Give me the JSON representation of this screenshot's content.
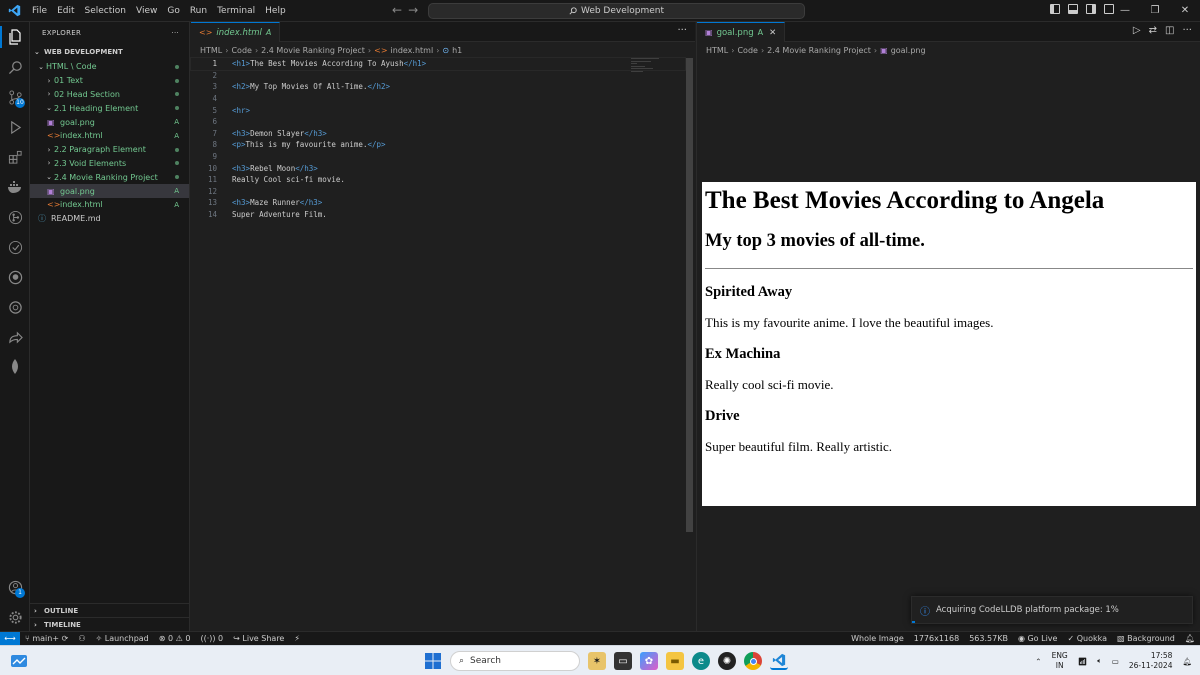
{
  "menu": [
    "File",
    "Edit",
    "Selection",
    "View",
    "Go",
    "Run",
    "Terminal",
    "Help"
  ],
  "command_center": "Web Development",
  "activity_badges": {
    "source_control": "10",
    "accounts": "1"
  },
  "explorer": {
    "title": "EXPLORER",
    "workspace": "WEB DEVELOPMENT",
    "items": [
      {
        "label": "HTML \\ Code",
        "status": "dot"
      },
      {
        "label": "01 Text",
        "status": "dot"
      },
      {
        "label": "02 Head Section",
        "status": "dot"
      },
      {
        "label": "2.1 Heading Element",
        "status": "dot"
      },
      {
        "label": "goal.png",
        "status": "A"
      },
      {
        "label": "index.html",
        "status": "A"
      },
      {
        "label": "2.2 Paragraph Element",
        "status": "dot"
      },
      {
        "label": "2.3 Void Elements",
        "status": "dot"
      },
      {
        "label": "2.4 Movie Ranking Project",
        "status": "dot"
      },
      {
        "label": "goal.png",
        "status": "A"
      },
      {
        "label": "index.html",
        "status": "A"
      },
      {
        "label": "README.md",
        "status": ""
      }
    ],
    "outline": "OUTLINE",
    "timeline": "TIMELINE"
  },
  "left_editor": {
    "tab_label": "index.html",
    "tab_status": "A",
    "breadcrumb": [
      "HTML",
      "Code",
      "2.4 Movie Ranking Project",
      "index.html",
      "h1"
    ],
    "lines": [
      {
        "n": "1",
        "pre": "",
        "open": "<h1>",
        "text": "The Best Movies According To Ayush",
        "close": "</h1>"
      },
      {
        "n": "2",
        "pre": "",
        "open": "",
        "text": "",
        "close": ""
      },
      {
        "n": "3",
        "pre": "",
        "open": "<h2>",
        "text": "My Top Movies Of All-Time.",
        "close": "</h2>"
      },
      {
        "n": "4",
        "pre": "",
        "open": "",
        "text": "",
        "close": ""
      },
      {
        "n": "5",
        "pre": "",
        "open": "<hr>",
        "text": "",
        "close": ""
      },
      {
        "n": "6",
        "pre": "",
        "open": "",
        "text": "",
        "close": ""
      },
      {
        "n": "7",
        "pre": "",
        "open": "<h3>",
        "text": "Demon Slayer",
        "close": "</h3>"
      },
      {
        "n": "8",
        "pre": "",
        "open": "<p>",
        "text": "This is my favourite anime.",
        "close": "</p>"
      },
      {
        "n": "9",
        "pre": "",
        "open": "",
        "text": "",
        "close": ""
      },
      {
        "n": "10",
        "pre": "",
        "open": "<h3>",
        "text": "Rebel Moon",
        "close": "</h3>"
      },
      {
        "n": "11",
        "pre": "",
        "open": "",
        "text": "Really Cool sci-fi movie.",
        "close": ""
      },
      {
        "n": "12",
        "pre": "",
        "open": "",
        "text": "",
        "close": ""
      },
      {
        "n": "13",
        "pre": "",
        "open": "<h3>",
        "text": "Maze Runner",
        "close": "</h3>"
      },
      {
        "n": "14",
        "pre": "",
        "open": "",
        "text": "Super Adventure Film.",
        "close": ""
      }
    ]
  },
  "right_editor": {
    "tab_label": "goal.png",
    "tab_status": "A",
    "breadcrumb": [
      "HTML",
      "Code",
      "2.4 Movie Ranking Project",
      "goal.png"
    ],
    "preview": {
      "h1": "The Best Movies According to Angela",
      "h2": "My top 3 movies of all-time.",
      "movies": [
        {
          "title": "Spirited Away",
          "desc": "This is my favourite anime. I love the beautiful images."
        },
        {
          "title": "Ex Machina",
          "desc": "Really cool sci-fi movie."
        },
        {
          "title": "Drive",
          "desc": "Super beautiful film. Really artistic."
        }
      ]
    }
  },
  "notification": "Acquiring CodeLLDB platform package: 1%",
  "statusbar": {
    "branch": "main+",
    "launchpad": "Launchpad",
    "errors": "0",
    "warnings": "0",
    "ports": "0",
    "live_share": "Live Share",
    "whole_image": "Whole Image",
    "dimensions": "1776x1168",
    "size": "563.57KB",
    "go_live": "Go Live",
    "quokka": "Quokka",
    "background": "Background"
  },
  "taskbar": {
    "search_placeholder": "Search",
    "lang_line1": "ENG",
    "lang_line2": "IN",
    "time": "17:58",
    "date": "26-11-2024"
  },
  "colors": {
    "accent": "#0078d4",
    "git_added": "#73c991",
    "tag": "#569cd6"
  }
}
